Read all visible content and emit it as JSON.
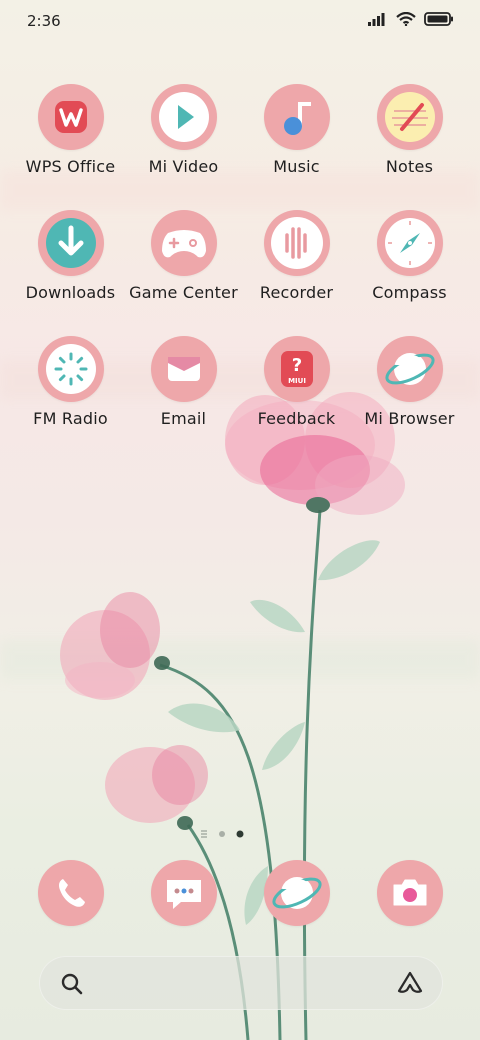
{
  "status_bar": {
    "time": "2:36"
  },
  "apps": [
    {
      "label": "WPS Office",
      "icon": "wps-office-icon"
    },
    {
      "label": "Mi Video",
      "icon": "play-icon"
    },
    {
      "label": "Music",
      "icon": "music-note-icon"
    },
    {
      "label": "Notes",
      "icon": "notepad-pencil-icon"
    },
    {
      "label": "Downloads",
      "icon": "download-arrow-icon"
    },
    {
      "label": "Game Center",
      "icon": "gamepad-icon"
    },
    {
      "label": "Recorder",
      "icon": "sound-wave-icon"
    },
    {
      "label": "Compass",
      "icon": "compass-icon"
    },
    {
      "label": "FM Radio",
      "icon": "radio-dial-icon"
    },
    {
      "label": "Email",
      "icon": "envelope-icon"
    },
    {
      "label": "Feedback",
      "icon": "feedback-icon",
      "badge": "MIUI",
      "glyph": "?"
    },
    {
      "label": "Mi Browser",
      "icon": "planet-icon"
    }
  ],
  "dock": [
    {
      "name": "phone",
      "icon": "phone-icon"
    },
    {
      "name": "messaging",
      "icon": "chat-bubble-icon"
    },
    {
      "name": "browser",
      "icon": "planet-icon"
    },
    {
      "name": "camera",
      "icon": "camera-icon"
    }
  ],
  "page_indicator": {
    "pages": 2,
    "current": 2
  },
  "colors": {
    "icon_bg": "#eea7aa",
    "accent_teal": "#4fb7b4",
    "accent_red": "#e24b55"
  }
}
